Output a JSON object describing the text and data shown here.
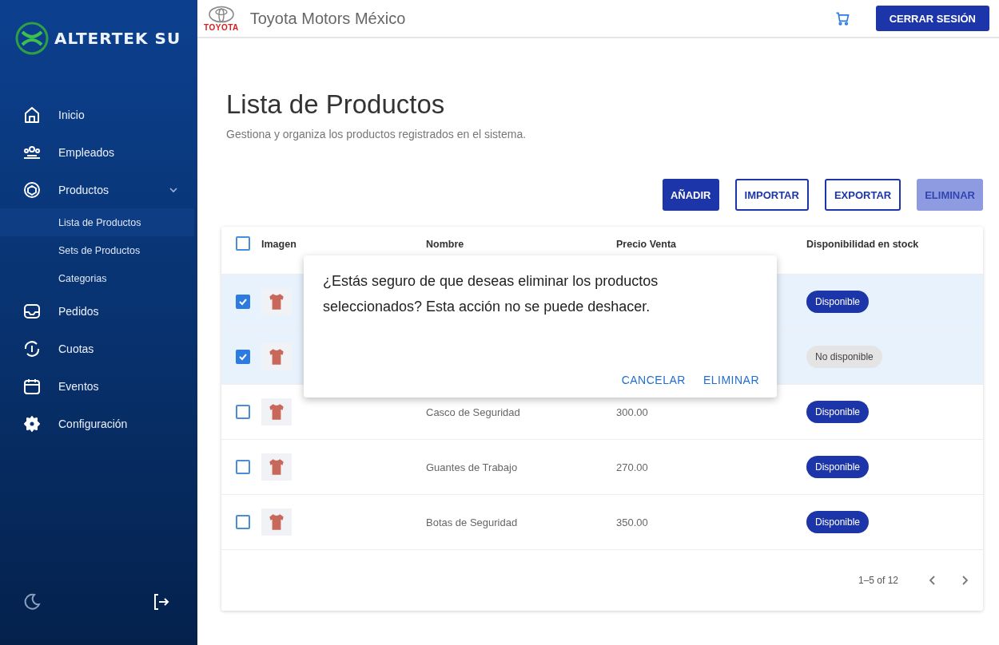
{
  "sidebar": {
    "brand": "ALTERTEK SU",
    "items": [
      {
        "label": "Inicio"
      },
      {
        "label": "Empleados"
      },
      {
        "label": "Productos",
        "expanded": true,
        "children": [
          {
            "label": "Lista de Productos",
            "selected": true
          },
          {
            "label": "Sets de Productos",
            "selected": false
          },
          {
            "label": "Categorias",
            "selected": false
          }
        ]
      },
      {
        "label": "Pedidos"
      },
      {
        "label": "Cuotas"
      },
      {
        "label": "Eventos"
      },
      {
        "label": "Configuración"
      }
    ]
  },
  "topbar": {
    "logo_text": "TOYOTA",
    "company": "Toyota Motors México",
    "logout": "CERRAR SESIÓN"
  },
  "page": {
    "title": "Lista de Productos",
    "subtitle": "Gestiona y organiza los productos registrados en el sistema."
  },
  "actions": [
    {
      "label": "AÑADIR",
      "kind": "primary",
      "disabled": false
    },
    {
      "label": "IMPORTAR",
      "kind": "outline",
      "disabled": false
    },
    {
      "label": "EXPORTAR",
      "kind": "outline",
      "disabled": false
    },
    {
      "label": "ELIMINAR",
      "kind": "primary",
      "disabled": true
    }
  ],
  "table": {
    "select_all_checked": false,
    "columns": [
      "Imagen",
      "Nombre",
      "Precio Venta",
      "Disponibilidad en stock"
    ],
    "rows": [
      {
        "selected": true,
        "status": "Disponible",
        "kind": "available"
      },
      {
        "selected": true,
        "status": "No disponible",
        "kind": "unavailable"
      },
      {
        "selected": false,
        "name": "Casco de Seguridad",
        "price": "300.00",
        "status": "Disponible",
        "kind": "available"
      },
      {
        "selected": false,
        "name": "Guantes de Trabajo",
        "price": "270.00",
        "status": "Disponible",
        "kind": "available"
      },
      {
        "selected": false,
        "name": "Botas de Seguridad",
        "price": "350.00",
        "status": "Disponible",
        "kind": "available"
      }
    ],
    "pagination": "1–5 of 12"
  },
  "dialog": {
    "message": "¿Estás seguro de que deseas eliminar los productos seleccionados? Esta acción no se puede deshacer.",
    "buttons": [
      "CANCELAR",
      "ELIMINAR"
    ]
  }
}
